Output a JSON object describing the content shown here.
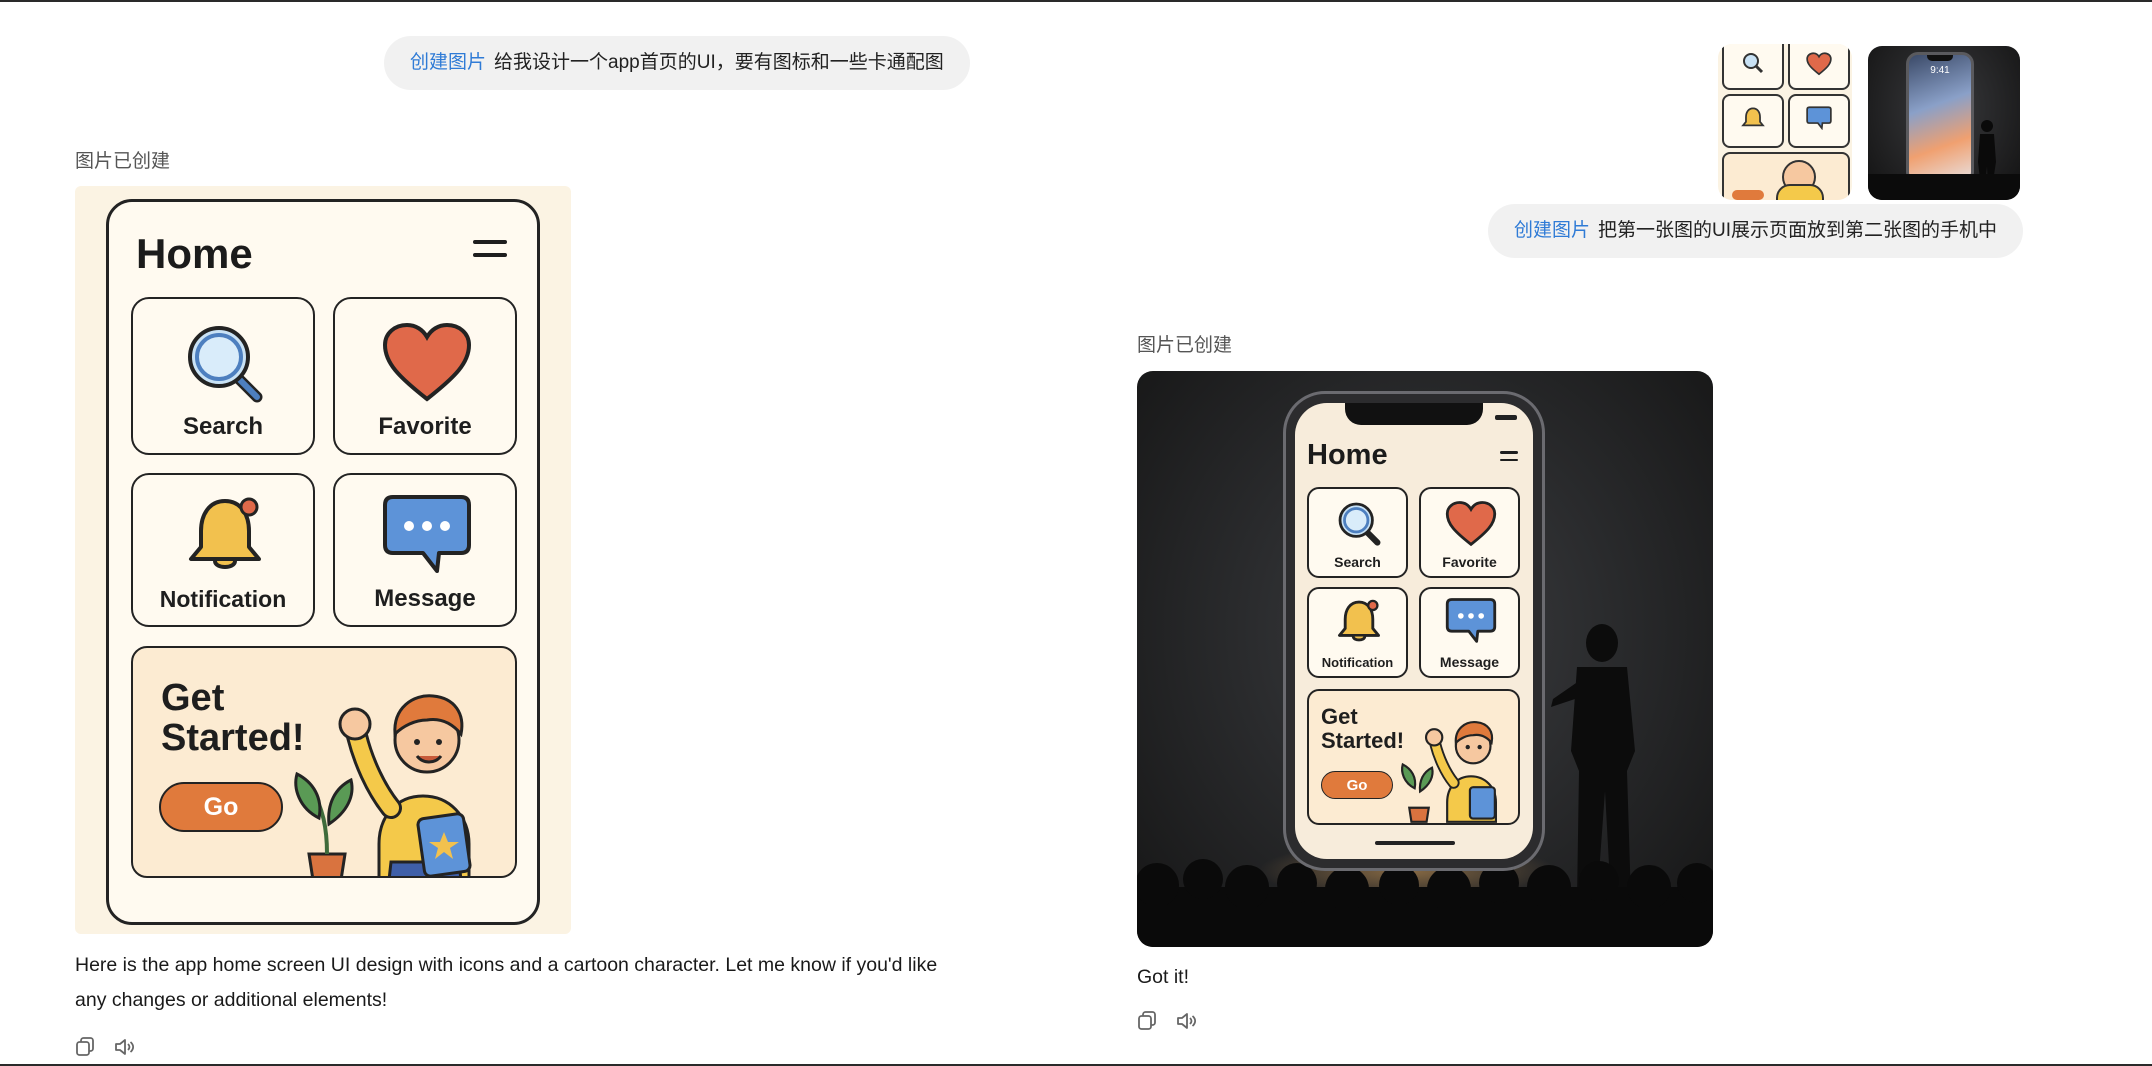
{
  "chat": {
    "message1": {
      "chip": "创建图片",
      "text": "给我设计一个app首页的UI，要有图标和一些卡通配图"
    },
    "status1": "图片已创建",
    "reply1": {
      "line1": "Here is the app home screen UI design with icons and a cartoon character. Let me know if you'd like",
      "line2": "any changes or additional elements!"
    },
    "message2": {
      "chip": "创建图片",
      "text": "把第一张图的UI展示页面放到第二张图的手机中"
    },
    "status2": "图片已创建",
    "reply2": "Got it!",
    "thumb_phone_time": "9:41"
  },
  "app_ui": {
    "title": "Home",
    "cards": {
      "search": "Search",
      "favorite": "Favorite",
      "notification": "Notification",
      "message": "Message"
    },
    "cta_line1": "Get",
    "cta_line2": "Started!",
    "go": "Go"
  },
  "icons": {
    "copy": "copy-icon",
    "speaker": "speaker-icon",
    "menu": "hamburger-menu-icon"
  },
  "colors": {
    "chip_blue": "#2f7bd6",
    "heart": "#e0694a",
    "bell": "#f2c14e",
    "chat_bubble": "#5d93d8",
    "go_button": "#e07a3c"
  }
}
